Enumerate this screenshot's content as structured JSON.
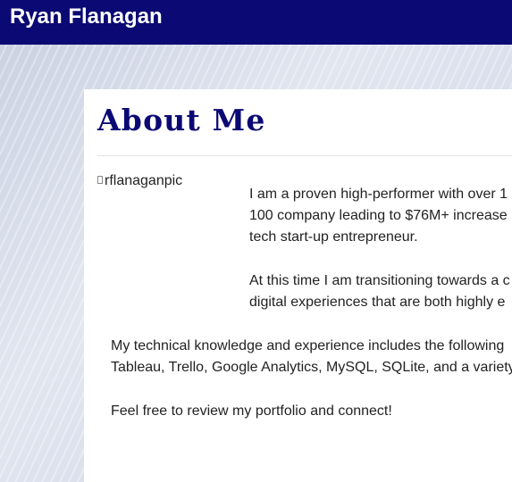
{
  "header": {
    "site_title": "Ryan Flanagan"
  },
  "about": {
    "heading": "About Me",
    "profile_image_alt": "rflanaganpic",
    "paragraph_1_lines": [
      "I am a proven high-performer with over 1",
      "100 company leading to $76M+ increase",
      "tech start-up entrepreneur."
    ],
    "paragraph_2_lines": [
      "At this time I am transitioning towards a c",
      "digital experiences that are both highly e"
    ],
    "paragraph_3_lines": [
      "My technical knowledge and experience includes the following",
      "Tableau, Trello, Google Analytics, MySQL, SQLite, and a variety"
    ],
    "paragraph_4_lines": [
      "Feel free to review my portfolio and connect!"
    ]
  },
  "colors": {
    "header_background": "#0b0973",
    "heading_text": "#0b0973",
    "body_text": "#222222",
    "card_background": "#ffffff"
  }
}
